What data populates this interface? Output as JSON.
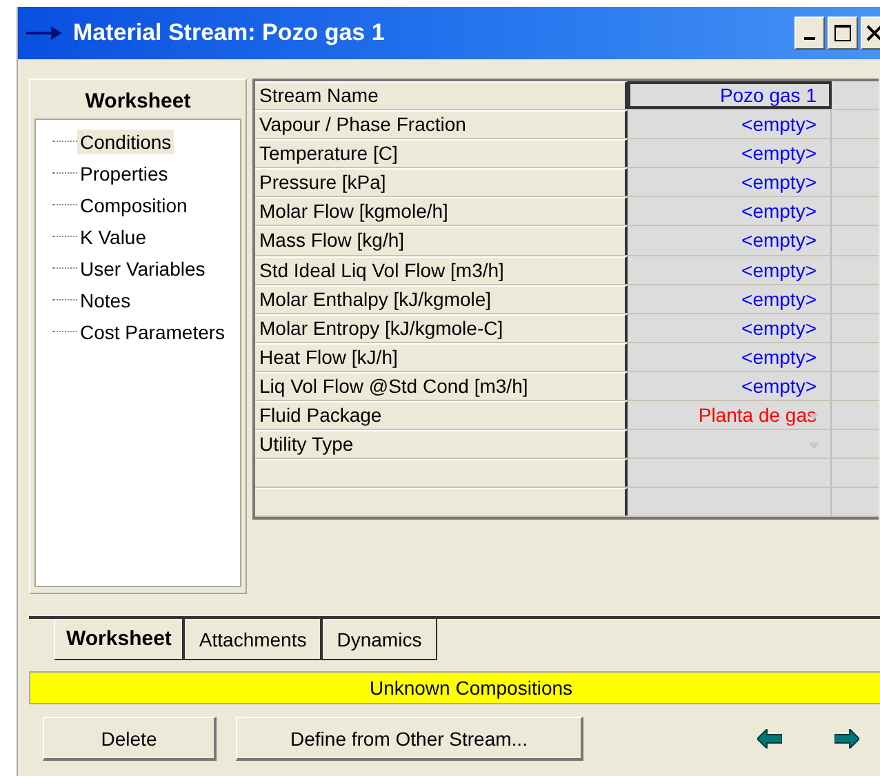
{
  "window": {
    "title": "Material Stream: Pozo gas 1"
  },
  "sidebar": {
    "title": "Worksheet",
    "items": [
      {
        "label": "Conditions",
        "selected": true
      },
      {
        "label": "Properties",
        "selected": false
      },
      {
        "label": "Composition",
        "selected": false
      },
      {
        "label": "K Value",
        "selected": false
      },
      {
        "label": "User Variables",
        "selected": false
      },
      {
        "label": "Notes",
        "selected": false
      },
      {
        "label": "Cost Parameters",
        "selected": false
      }
    ]
  },
  "table": {
    "rows": [
      {
        "label": "Stream Name",
        "value": "Pozo gas 1",
        "kind": "text",
        "color": "#0000ff",
        "selected": true
      },
      {
        "label": "Vapour / Phase Fraction",
        "value": "<empty>",
        "kind": "text",
        "color": "#0000ff",
        "selected": false
      },
      {
        "label": "Temperature [C]",
        "value": "<empty>",
        "kind": "text",
        "color": "#0000ff",
        "selected": false
      },
      {
        "label": "Pressure [kPa]",
        "value": "<empty>",
        "kind": "text",
        "color": "#0000ff",
        "selected": false
      },
      {
        "label": "Molar Flow [kgmole/h]",
        "value": "<empty>",
        "kind": "text",
        "color": "#0000ff",
        "selected": false
      },
      {
        "label": "Mass Flow [kg/h]",
        "value": "<empty>",
        "kind": "text",
        "color": "#0000ff",
        "selected": false
      },
      {
        "label": "Std Ideal Liq Vol Flow [m3/h]",
        "value": "<empty>",
        "kind": "text",
        "color": "#0000ff",
        "selected": false
      },
      {
        "label": "Molar Enthalpy [kJ/kgmole]",
        "value": "<empty>",
        "kind": "text",
        "color": "#0000ff",
        "selected": false
      },
      {
        "label": "Molar Entropy [kJ/kgmole-C]",
        "value": "<empty>",
        "kind": "text",
        "color": "#0000ff",
        "selected": false
      },
      {
        "label": "Heat Flow [kJ/h]",
        "value": "<empty>",
        "kind": "text",
        "color": "#0000ff",
        "selected": false
      },
      {
        "label": "Liq Vol Flow @Std Cond [m3/h]",
        "value": "<empty>",
        "kind": "text",
        "color": "#0000ff",
        "selected": false
      },
      {
        "label": "Fluid Package",
        "value": "Planta de gas",
        "kind": "dropdown",
        "color": "#ff0000",
        "selected": false
      },
      {
        "label": "Utility Type",
        "kind": "dropdown",
        "selected": false
      }
    ]
  },
  "tabs": [
    {
      "label": "Worksheet",
      "selected": true
    },
    {
      "label": "Attachments",
      "selected": false
    },
    {
      "label": "Dynamics",
      "selected": false
    }
  ],
  "status_bar": {
    "text": "Unknown Compositions"
  },
  "buttons": [
    "Delete",
    "Define from Other Stream..."
  ]
}
